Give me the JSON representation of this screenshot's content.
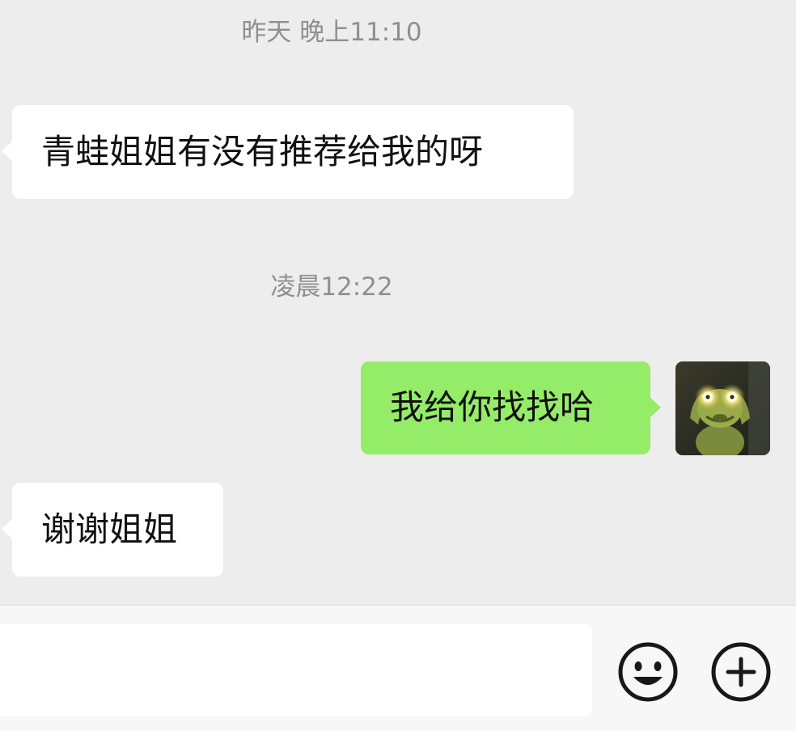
{
  "chat": {
    "timestamps": [
      "昨天 晚上11:10",
      "凌晨12:22"
    ],
    "messages": [
      {
        "side": "left",
        "text": "青蛙姐姐有没有推荐给我的呀"
      },
      {
        "side": "right",
        "text": "我给你找找哈"
      },
      {
        "side": "left",
        "text": "谢谢姐姐"
      }
    ],
    "avatar": {
      "icon": "frog-avatar"
    }
  },
  "input_bar": {
    "value": "",
    "placeholder": "",
    "icons": [
      "emoji-icon",
      "plus-icon"
    ]
  },
  "colors": {
    "background": "#ededed",
    "incoming_bubble": "#ffffff",
    "outgoing_bubble": "#95ec69",
    "timestamp_text": "#8f8f8f"
  }
}
